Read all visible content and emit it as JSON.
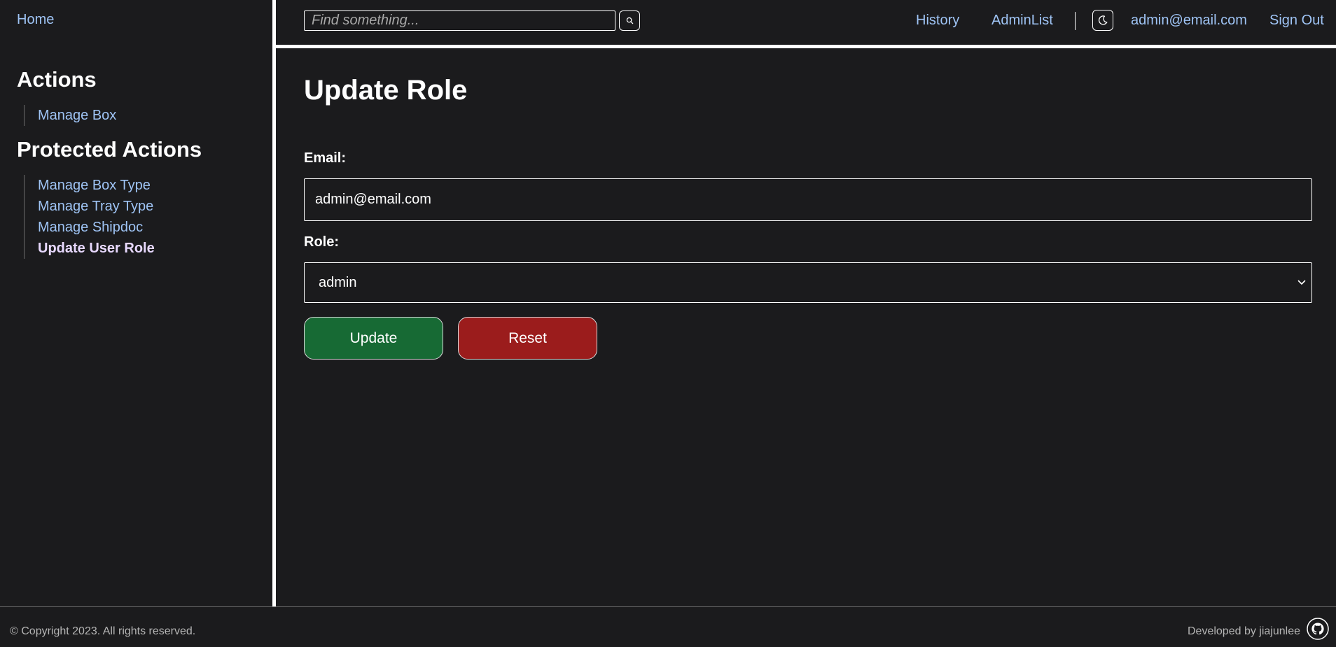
{
  "sidebar": {
    "home_label": "Home",
    "sections": [
      {
        "title": "Actions",
        "items": [
          {
            "label": "Manage Box",
            "active": false
          }
        ]
      },
      {
        "title": "Protected Actions",
        "items": [
          {
            "label": "Manage Box Type",
            "active": false
          },
          {
            "label": "Manage Tray Type",
            "active": false
          },
          {
            "label": "Manage Shipdoc",
            "active": false
          },
          {
            "label": "Update User Role",
            "active": true
          }
        ]
      }
    ]
  },
  "topbar": {
    "search": {
      "placeholder": "Find something...",
      "value": ""
    },
    "links": {
      "history": "History",
      "adminlist": "AdminList",
      "user_email": "admin@email.com",
      "sign_out": "Sign Out"
    },
    "icons": {
      "search": "search-icon",
      "theme": "moon-icon"
    }
  },
  "main": {
    "title": "Update Role",
    "email_label": "Email:",
    "email_value": "admin@email.com",
    "role_label": "Role:",
    "role_value": "admin",
    "update_label": "Update",
    "reset_label": "Reset"
  },
  "footer": {
    "copyright": "© Copyright 2023. All rights reserved.",
    "developer": "Developed by jiajunlee",
    "icon": "github-icon"
  },
  "colors": {
    "background": "#1b1b1d",
    "link": "#9fc4f5",
    "active_link": "#e8d9ff",
    "update_button": "#176a34",
    "reset_button": "#9b1c1c"
  }
}
